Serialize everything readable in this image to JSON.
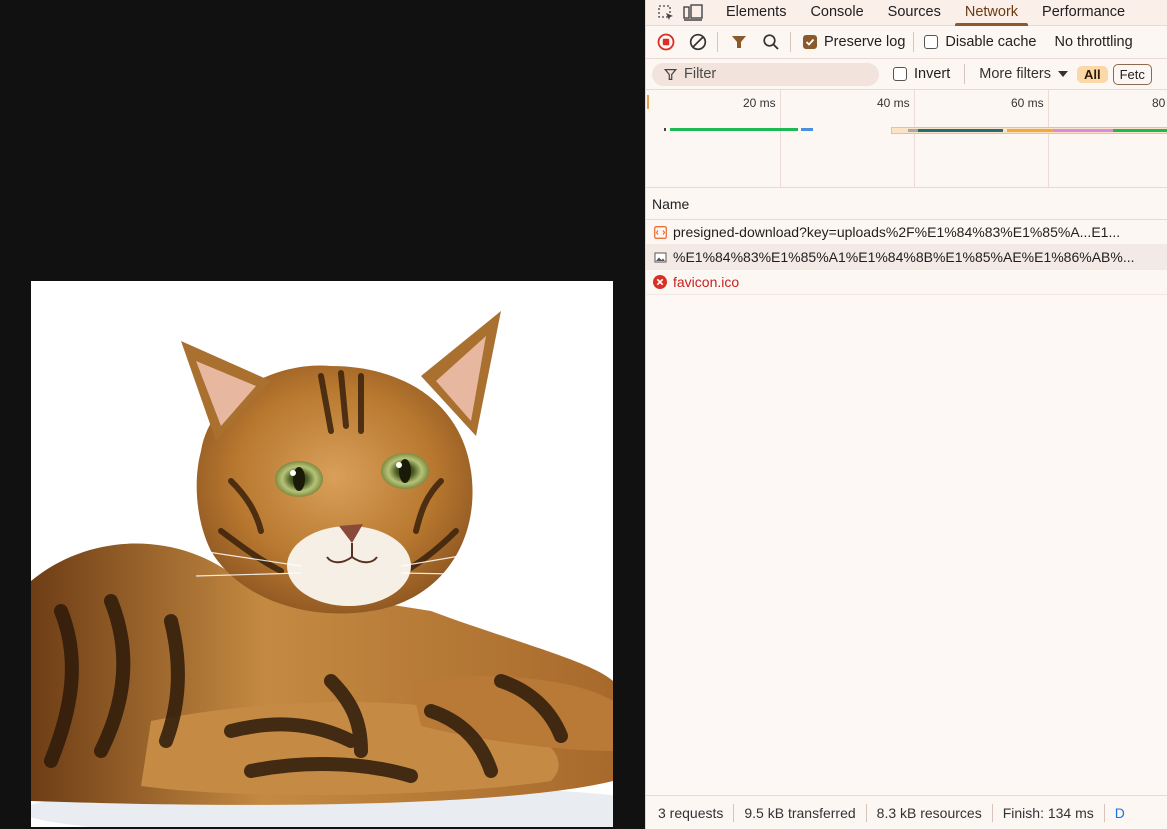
{
  "viewport": {
    "image": {
      "subject": "bengal-cat",
      "background": "#ffffff"
    }
  },
  "devtools": {
    "tabs": [
      {
        "label": "Elements",
        "active": false
      },
      {
        "label": "Console",
        "active": false
      },
      {
        "label": "Sources",
        "active": false
      },
      {
        "label": "Network",
        "active": true
      },
      {
        "label": "Performance",
        "active": false
      }
    ],
    "toolbar": {
      "preserve_log": {
        "label": "Preserve log",
        "checked": true
      },
      "disable_cache": {
        "label": "Disable cache",
        "checked": false
      },
      "throttling": "No throttling"
    },
    "filterbar": {
      "filter_placeholder": "Filter",
      "invert_label": "Invert",
      "more_filters": "More filters",
      "type_all": "All",
      "type_fetch": "Fetc"
    },
    "overview": {
      "ticks": [
        "20 ms",
        "40 ms",
        "60 ms",
        "80"
      ]
    },
    "table": {
      "name_header": "Name",
      "rows": [
        {
          "name": "presigned-download?key=uploads%2F%E1%84%83%E1%85%A...E1...",
          "type": "document",
          "icon": "document-icon",
          "error": false
        },
        {
          "name": "%E1%84%83%E1%85%A1%E1%84%8B%E1%85%AE%E1%86%AB%...",
          "type": "image",
          "icon": "image-icon",
          "error": false
        },
        {
          "name": "favicon.ico",
          "type": "error",
          "icon": "error-icon",
          "error": true
        }
      ]
    },
    "status": {
      "requests": "3 requests",
      "transferred": "9.5 kB transferred",
      "resources": "8.3 kB resources",
      "finish": "Finish: 134 ms",
      "cut": "D"
    },
    "colors": {
      "accent": "#8a5a2c",
      "error": "#c5221f",
      "record": "#d93025",
      "link_blue": "#1a73e8"
    }
  }
}
